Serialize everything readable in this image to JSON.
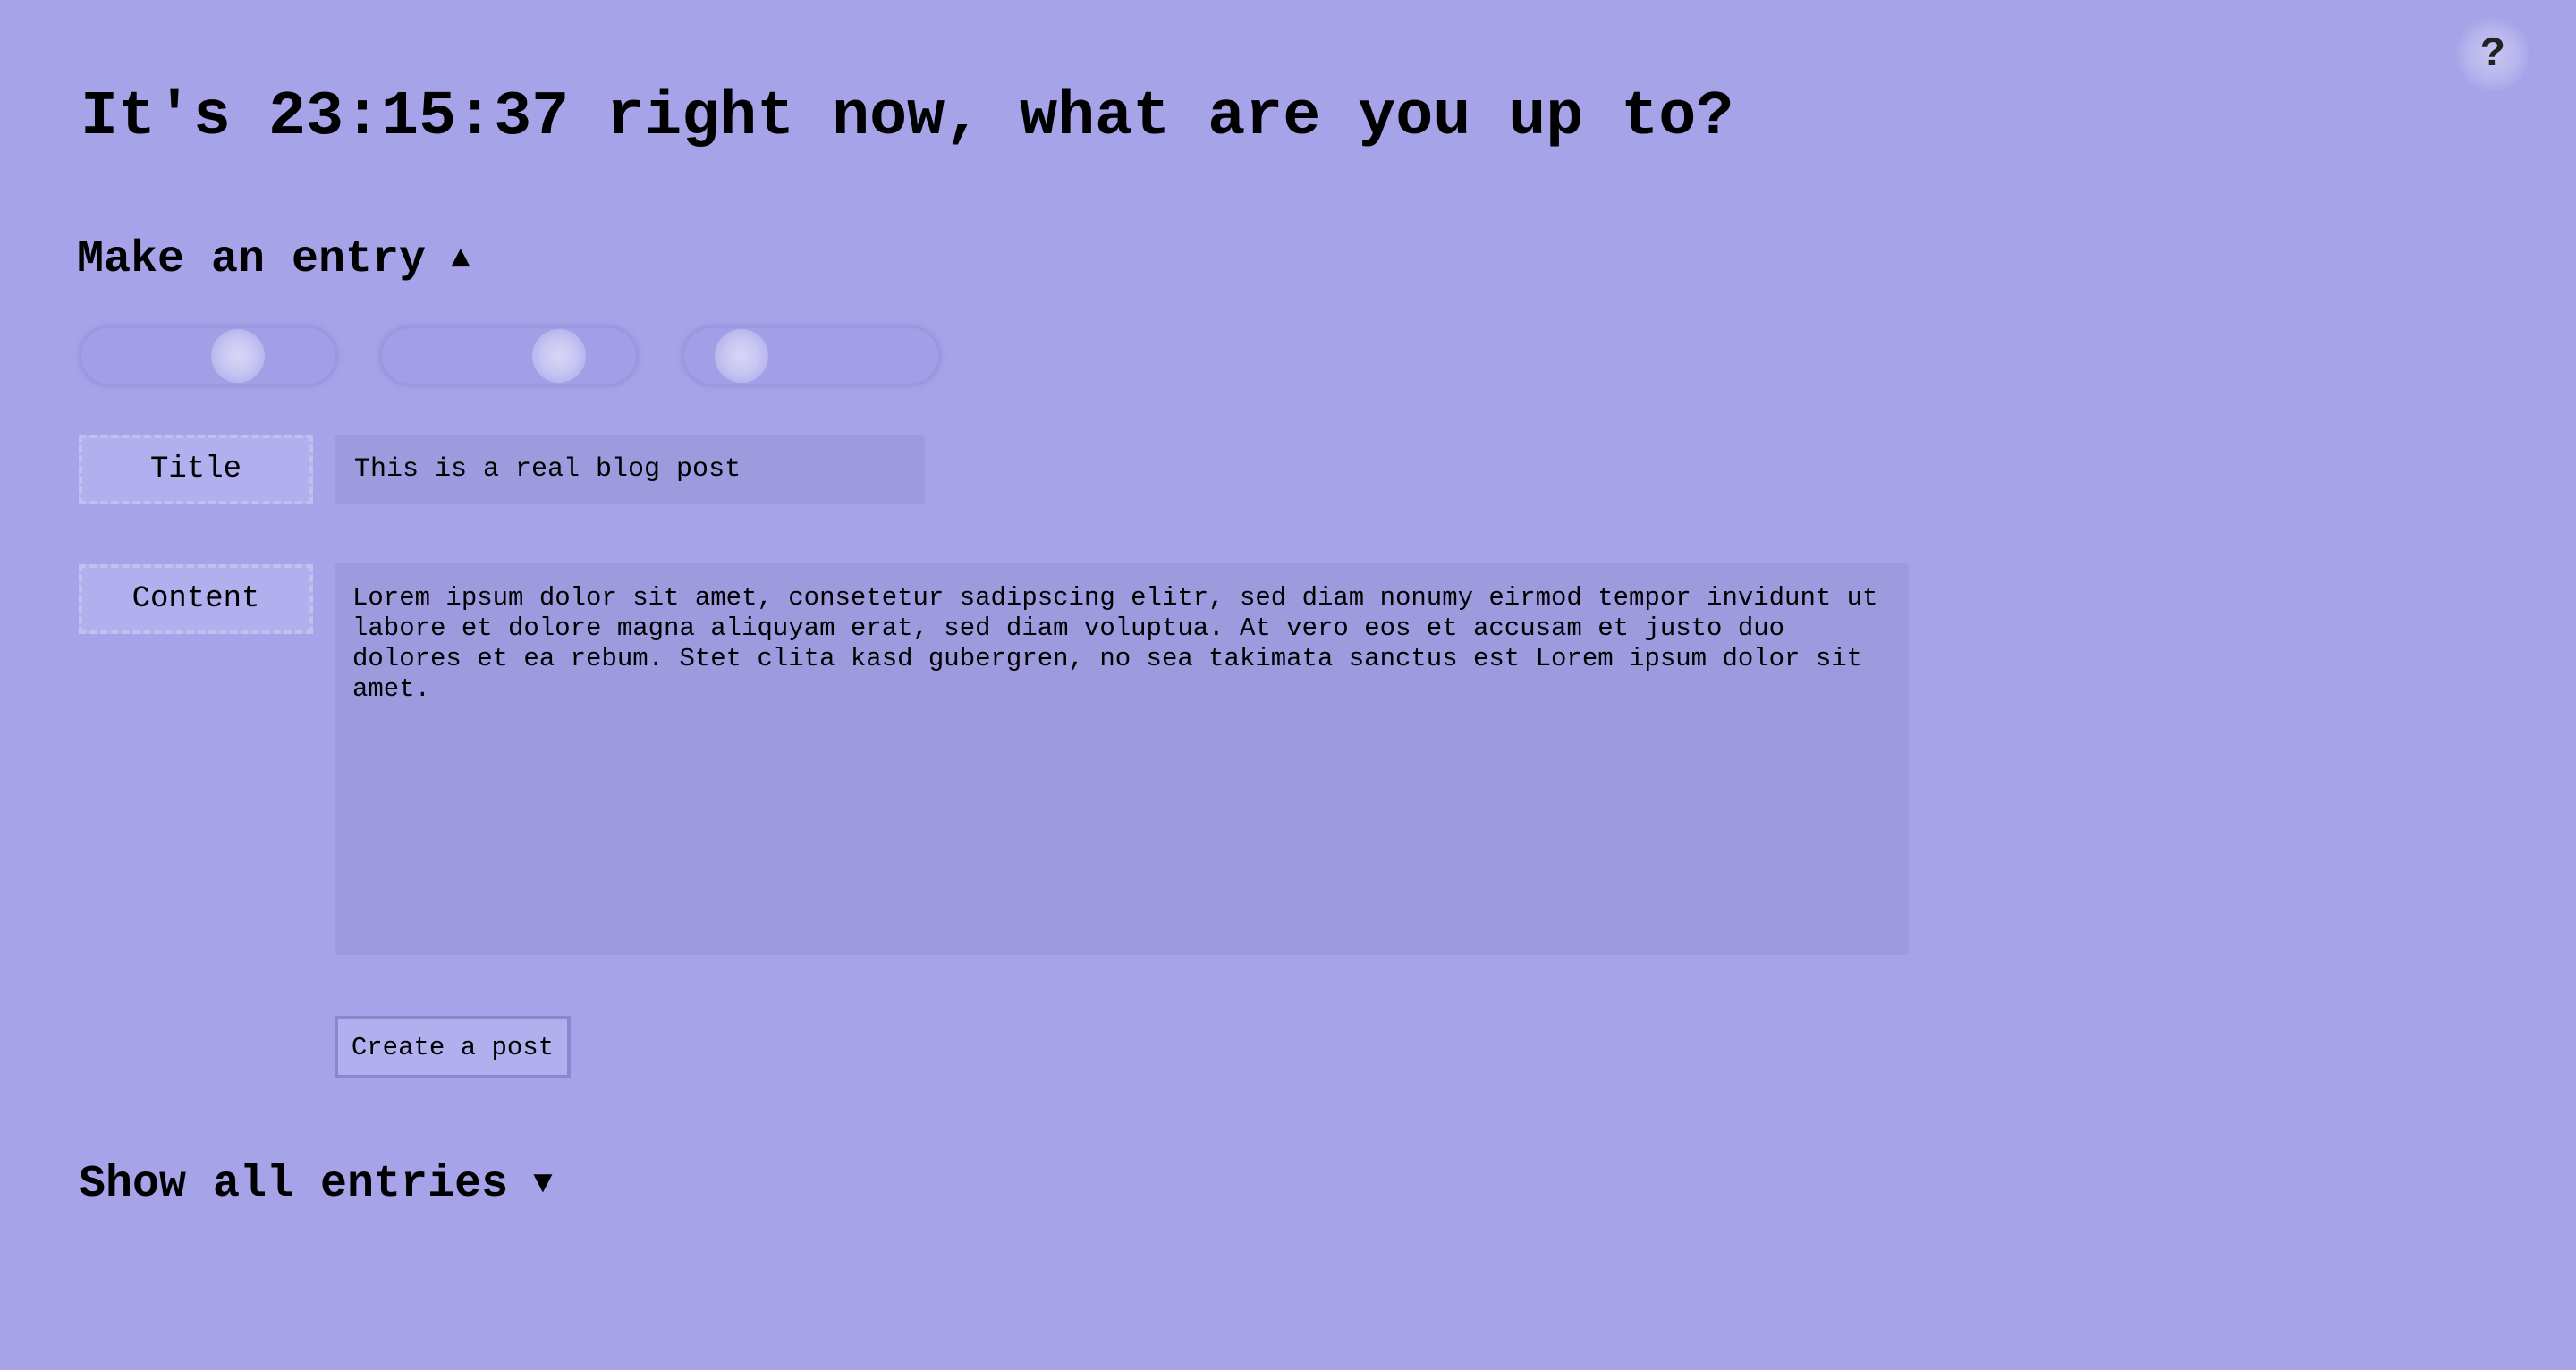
{
  "help": {
    "label": "?"
  },
  "headline": "It's 23:15:37 right now, what are you up to?",
  "make_entry": {
    "label": "Make an entry",
    "arrow": "▲"
  },
  "sliders": [
    {
      "value": 0.65
    },
    {
      "value": 0.75
    },
    {
      "value": 0.15
    }
  ],
  "form": {
    "title_label": "Title",
    "title_value": "This is a real blog post",
    "content_label": "Content",
    "content_value": "Lorem ipsum dolor sit amet, consetetur sadipscing elitr, sed diam nonumy eirmod tempor invidunt ut labore et dolore magna aliquyam erat, sed diam voluptua. At vero eos et accusam et justo duo dolores et ea rebum. Stet clita kasd gubergren, no sea takimata sanctus est Lorem ipsum dolor sit amet.",
    "submit_label": "Create a post"
  },
  "show_entries": {
    "label": "Show all entries",
    "arrow": "▼"
  }
}
